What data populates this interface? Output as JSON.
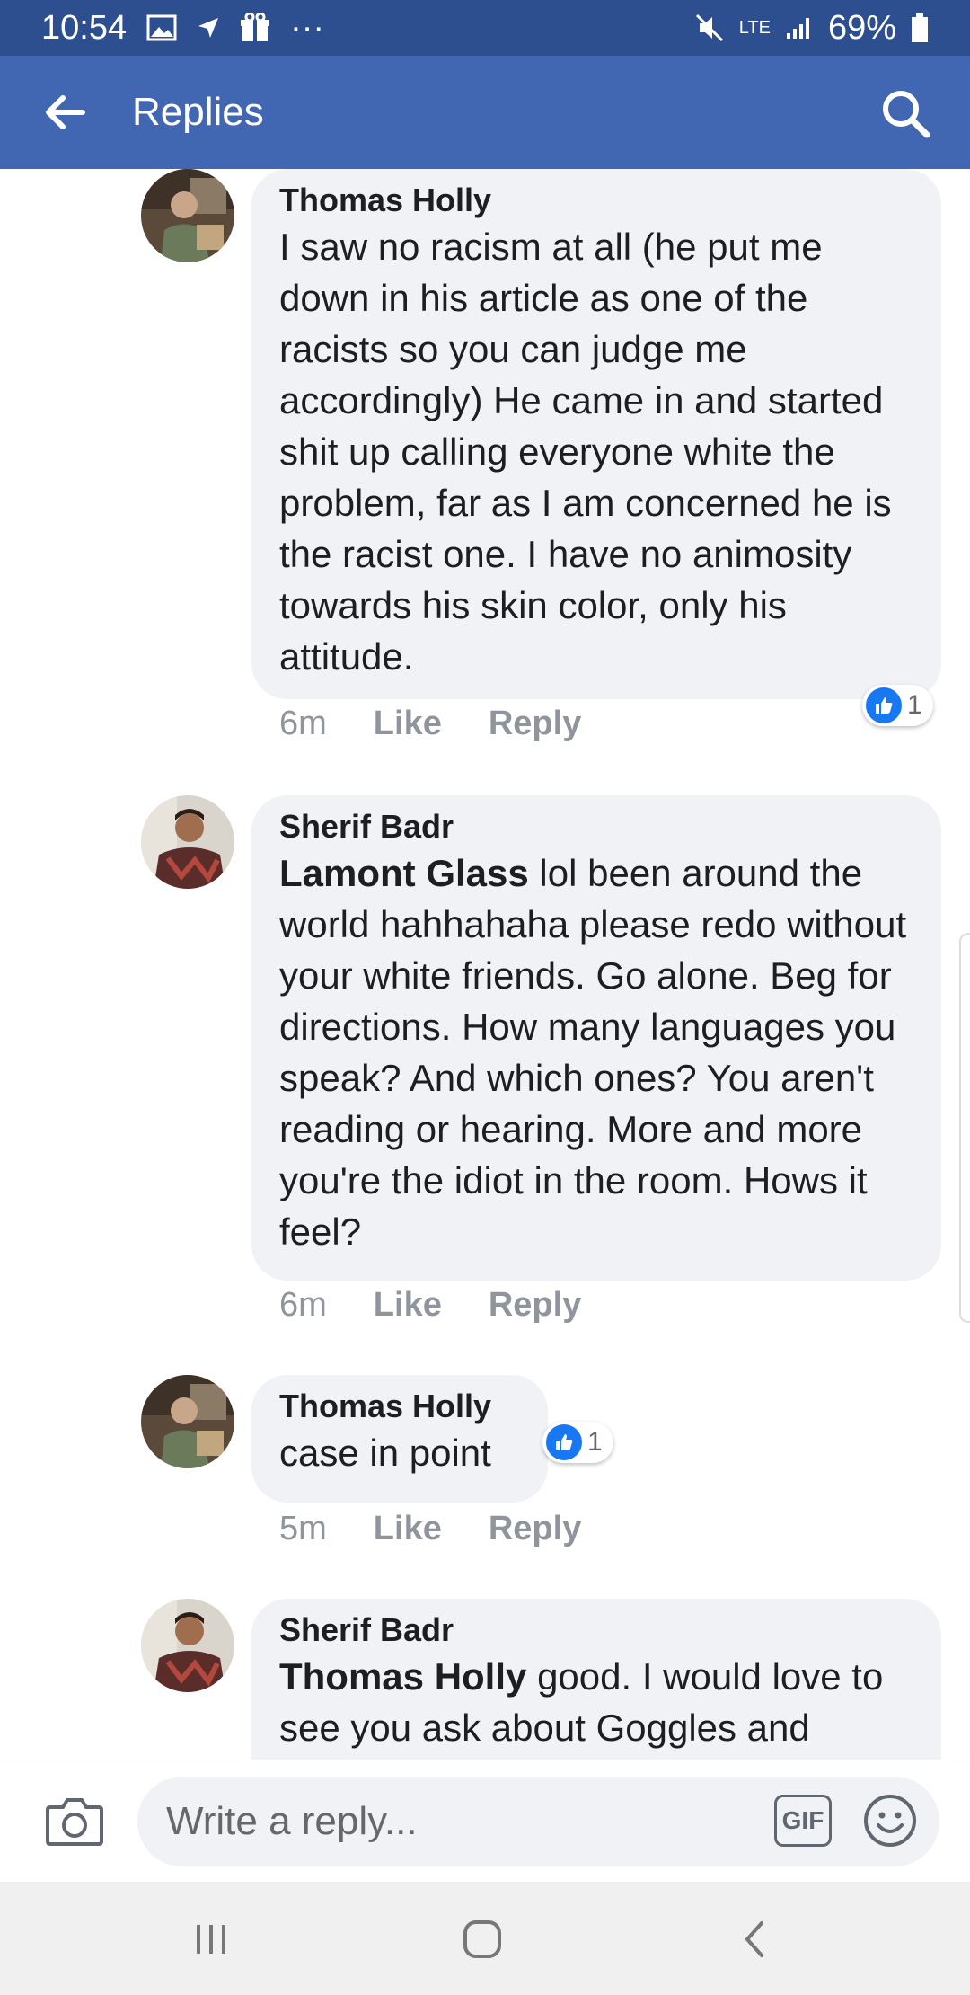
{
  "status_bar": {
    "time": "10:54",
    "network": "LTE",
    "battery": "69%",
    "more": "···"
  },
  "app_bar": {
    "title": "Replies",
    "back_icon": "arrow-left-icon",
    "search_icon": "search-icon"
  },
  "comments": [
    {
      "author": "Thomas Holly",
      "mention": "",
      "text": "I saw no racism at all (he put me down in his article as one of the racists so you can judge me accordingly) He came in and started shit up calling everyone white the problem, far as I am concerned he is the racist one. I have no animosity towards his skin color, only his attitude.",
      "time": "6m",
      "like_label": "Like",
      "reply_label": "Reply",
      "reaction_count": "1"
    },
    {
      "author": "Sherif Badr",
      "mention": "Lamont Glass",
      "text": "lol been around the world hahhahaha please redo without your white friends. Go alone. Beg for directions. How many languages you speak? And which ones? You aren't reading or hearing. More and more you're the idiot in the room. Hows it feel?",
      "time": "6m",
      "like_label": "Like",
      "reply_label": "Reply"
    },
    {
      "author": "Thomas Holly",
      "mention": "",
      "text": "case in point",
      "time": "5m",
      "like_label": "Like",
      "reply_label": "Reply",
      "reaction_count": "1"
    },
    {
      "author": "Sherif Badr",
      "mention": "Thomas Holly",
      "text": "good. I would love to see you ask about Goggles and"
    }
  ],
  "composer": {
    "placeholder": "Write a reply...",
    "gif_label": "GIF",
    "camera_icon": "camera-icon",
    "emoji_icon": "smiley-icon"
  },
  "colors": {
    "status_bar": "#2e4f8f",
    "app_bar": "#4267b2",
    "bubble": "#f0f2f5",
    "like_blue": "#1877f2",
    "meta_gray": "#90949c"
  }
}
